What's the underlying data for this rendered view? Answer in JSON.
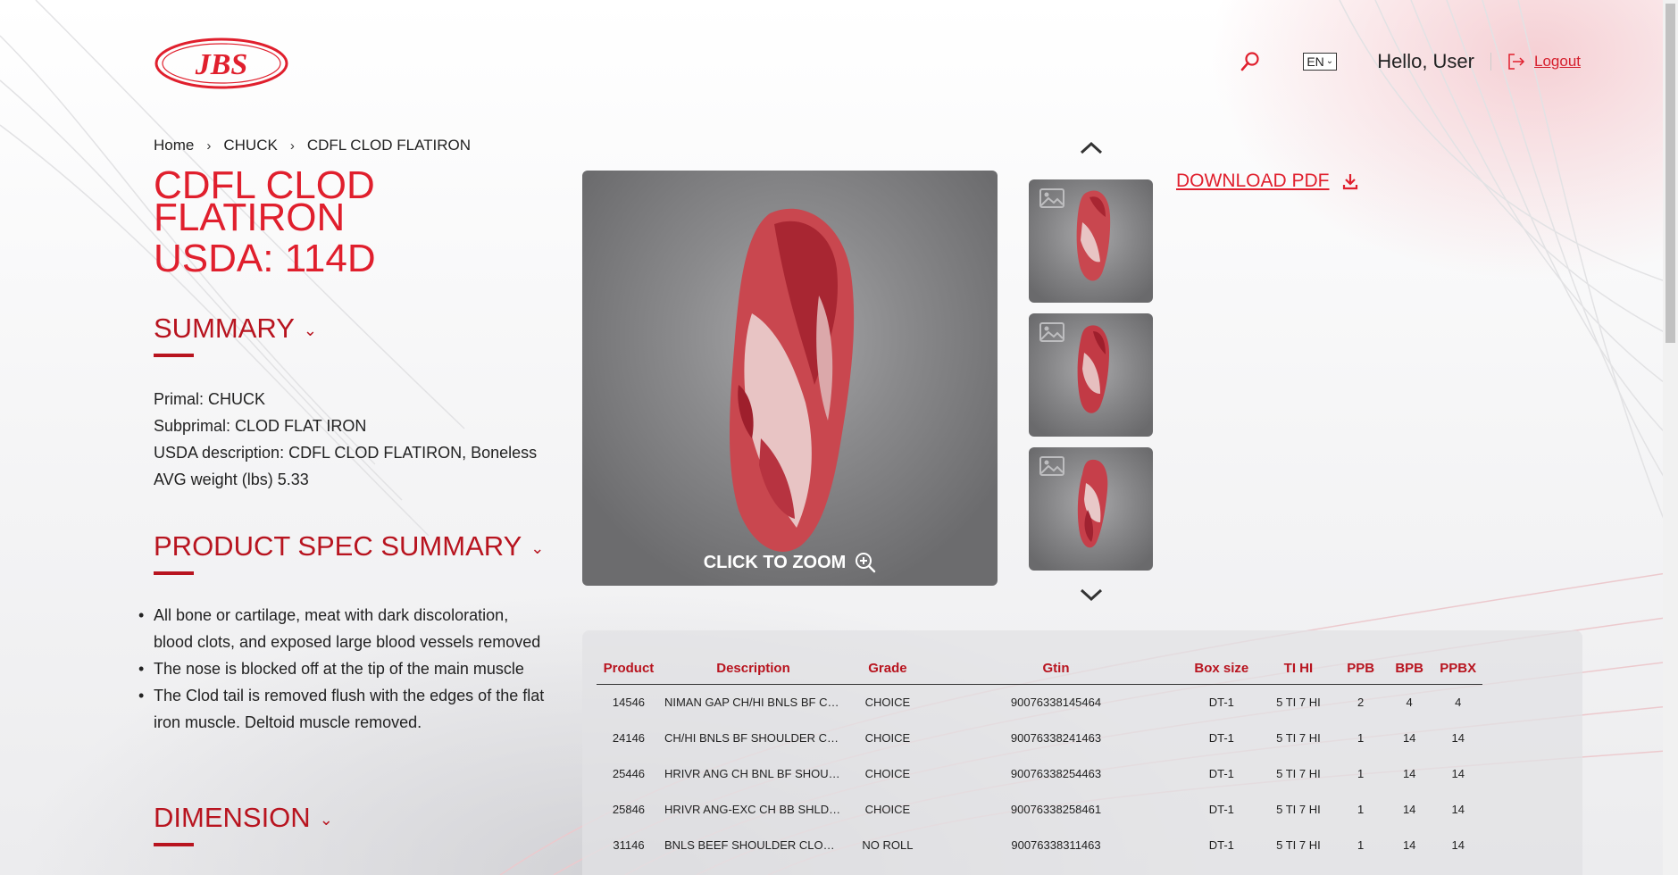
{
  "header": {
    "logo_text": "JBS",
    "language": "EN",
    "greeting": "Hello, User",
    "logout_label": "Logout"
  },
  "breadcrumb": [
    "Home",
    "CHUCK",
    "CDFL CLOD FLATIRON"
  ],
  "product": {
    "title": "CDFL CLOD FLATIRON",
    "usda": "USDA: 114D"
  },
  "summary": {
    "heading": "SUMMARY",
    "lines": [
      "Primal: CHUCK",
      "Subprimal: CLOD FLAT IRON",
      "USDA description: CDFL CLOD FLATIRON, Boneless",
      "AVG weight (lbs) 5.33"
    ]
  },
  "spec_summary": {
    "heading": "PRODUCT SPEC SUMMARY",
    "items": [
      "All bone or cartilage, meat with dark discoloration, blood clots, and exposed large blood vessels removed",
      "The nose is blocked off at the tip of the main muscle",
      "The Clod tail is removed flush with the edges of the flat iron muscle. Deltoid muscle removed."
    ]
  },
  "dimension": {
    "heading": "DIMENSION"
  },
  "gallery": {
    "zoom_label": "CLICK TO ZOOM"
  },
  "download_label": "DOWNLOAD PDF",
  "table": {
    "columns": [
      "Product",
      "Description",
      "Grade",
      "Gtin",
      "Box size",
      "TI HI",
      "PPB",
      "BPB",
      "PPBX"
    ],
    "rows": [
      [
        "14546",
        "NIMAN GAP CH/HI BNLS BF CHUCK...",
        "CHOICE",
        "90076338145464",
        "DT-1",
        "5 TI 7 HI",
        "2",
        "4",
        "4"
      ],
      [
        "24146",
        "CH/HI BNLS BF SHOULDER CLOD (T...",
        "CHOICE",
        "90076338241463",
        "DT-1",
        "5 TI 7 HI",
        "1",
        "14",
        "14"
      ],
      [
        "25446",
        "HRIVR ANG CH BNL BF SHOULD CLD...",
        "CHOICE",
        "90076338254463",
        "DT-1",
        "5 TI 7 HI",
        "1",
        "14",
        "14"
      ],
      [
        "25846",
        "HRIVR ANG-EXC CH BB SHLDR CLOD...",
        "CHOICE",
        "90076338258461",
        "DT-1",
        "5 TI 7 HI",
        "1",
        "14",
        "14"
      ],
      [
        "31146",
        "BNLS BEEF SHOULDER CLOD (TOP B...",
        "NO ROLL",
        "90076338311463",
        "DT-1",
        "5 TI 7 HI",
        "1",
        "14",
        "14"
      ]
    ]
  },
  "colors": {
    "brand_red": "#e01f2d",
    "heading_red": "#b8141f"
  }
}
